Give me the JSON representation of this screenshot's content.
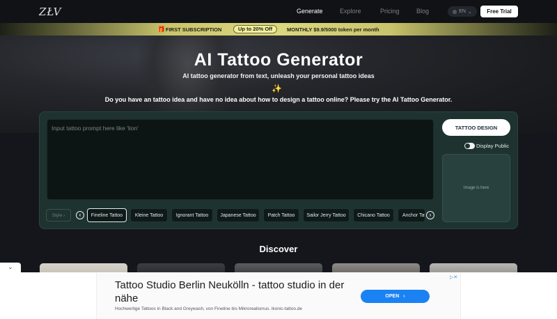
{
  "nav": {
    "logo": "ZŁV",
    "links": [
      "Generate",
      "Explore",
      "Pricing",
      "Blog"
    ],
    "lang": "EN",
    "trial": "Free Trial"
  },
  "promo": {
    "first": "FIRST SUBSCRIPTION",
    "badge": "Up to 20% Off",
    "monthly": "MONTHLY $9.9/5000 token per month"
  },
  "hero": {
    "title": "AI Tattoo Generator",
    "subtitle": "AI tattoo generator from text, unleash your personal tattoo ideas",
    "sparkle": "✨",
    "question": "Do you have an tattoo idea and have no idea about how to design a tattoo online? Please try the AI Tattoo Generator."
  },
  "generator": {
    "placeholder": "Input tattoo prompt here like 'lion'",
    "design_button": "TATTOO DESIGN",
    "display_public": "Display Public",
    "image_placeholder": "Image is here",
    "style_button": "Style",
    "styles": [
      "Fineline Tattoo",
      "Kleine Tattoo",
      "Ignorant Tattoo",
      "Japanese Tattoo",
      "Patch Tattoo",
      "Sailor Jerry Tattoo",
      "Chicano Tattoo",
      "Anchor Tattoo"
    ],
    "active_style": "Fineline Tattoo"
  },
  "discover": {
    "heading": "Discover"
  },
  "ad": {
    "title": "Tattoo Studio Berlin Neukölln - tattoo studio in der nähe",
    "description": "Hochwertige Tattoos in Black and Greywash, von Fineline bis Mikrorealismus. ikonic-tattoo.de",
    "open": "OPEN"
  },
  "colors": {
    "accent_panel": "#1e3230",
    "promo_gold": "#dcd880",
    "ad_button": "#1a82f3"
  }
}
